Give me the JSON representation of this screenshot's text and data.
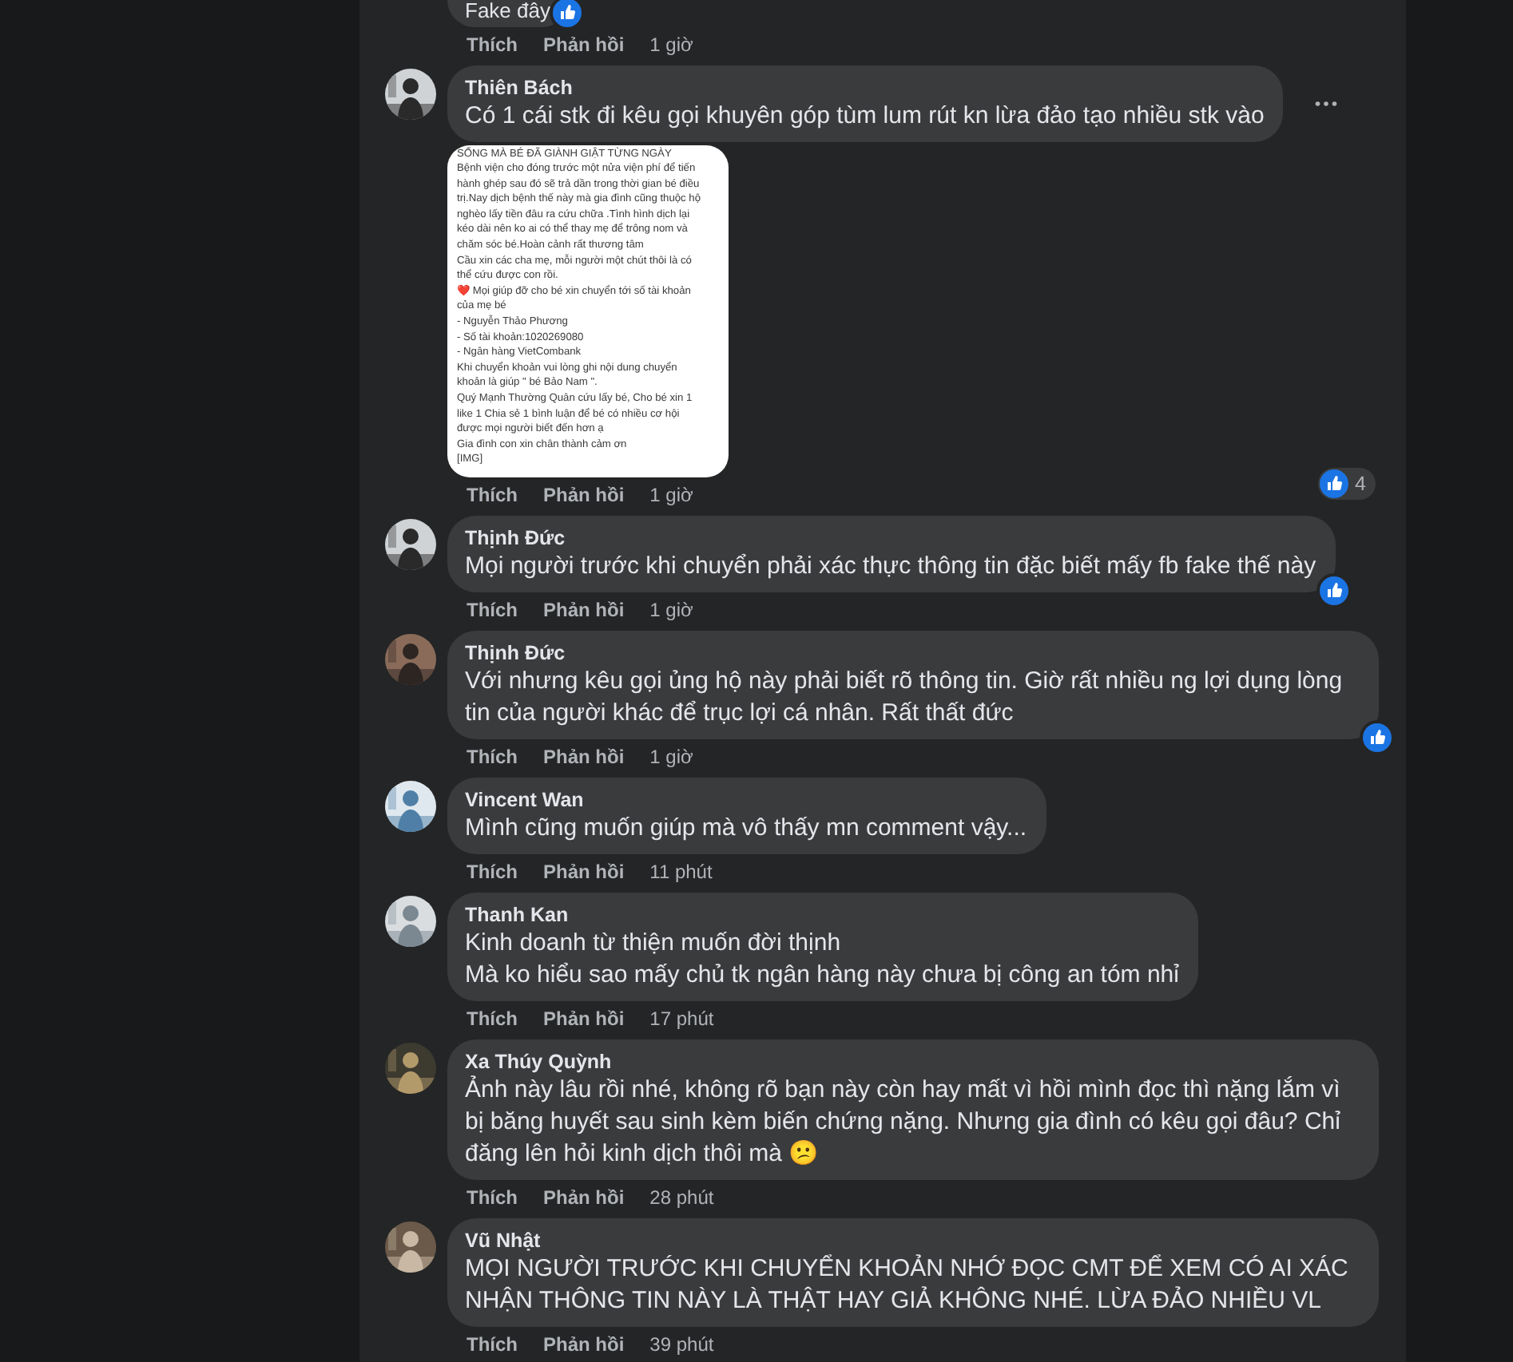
{
  "comments": [
    {
      "text": "Fake đây",
      "reaction": {
        "kind": "like"
      },
      "actions": {
        "like": "Thích",
        "reply": "Phản hồi",
        "time": "1 giờ"
      }
    },
    {
      "author": "Thiên Bách",
      "text": "Có 1 cái stk đi kêu gọi khuyên góp tùm lum rút kn lừa đảo tạo nhiều stk vào",
      "menu_button": true,
      "attachment": {
        "lines": [
          "SỐNG MÀ BÉ ĐÃ GIÀNH GIẬT TỪNG NGÀY",
          "Bệnh viện cho đóng trước một nửa viện phí để tiến",
          "hành ghép sau đó sẽ trả dần trong thời gian bé điều",
          "trị.Nay dịch bệnh thế này mà gia đình cũng thuộc hộ",
          "nghèo lấy tiền đâu ra cứu chữa .Tình hình dịch lại",
          "kéo dài nên ko ai có thể thay mẹ để trông nom và",
          "chăm sóc bé.Hoàn cảnh rất thương tâm",
          "Cầu xin các cha mẹ, mỗi người một chút thôi là có",
          "thể cứu được con rồi.",
          "❤️ Mọi giúp đỡ cho bé xin chuyển tới số tài khoản",
          "của mẹ bé",
          "- Nguyễn Thảo Phương",
          "- Số tài khoản:1020269080",
          "- Ngân hàng VietCombank",
          "Khi chuyển khoản vui lòng ghi nội dung chuyển",
          "khoản là giúp \" bé Bảo Nam \".",
          "Quý Mạnh Thường Quân cứu lấy bé, Cho bé xin 1",
          "like 1 Chia sẻ 1 bình luận để bé có nhiều cơ hội",
          "được mọi người biết đến hơn ạ",
          "Gia đình con xin chân thành cảm ơn",
          "[IMG]"
        ],
        "reaction": {
          "kind": "like",
          "count": "4"
        }
      },
      "actions": {
        "like": "Thích",
        "reply": "Phản hồi",
        "time": "1 giờ"
      }
    },
    {
      "author": "Thịnh Đức",
      "text": "Mọi người trước khi chuyển phải xác thực thông tin đặc biết mấy fb fake thế này",
      "reaction": {
        "kind": "like"
      },
      "actions": {
        "like": "Thích",
        "reply": "Phản hồi",
        "time": "1 giờ"
      }
    },
    {
      "author": "Thịnh Đức",
      "text": "Với nhưng kêu gọi ủng hộ này phải biết rõ thông tin. Giờ rất nhiều ng lợi dụng lòng tin của người khác để trục lợi cá nhân. Rất thất đức",
      "reaction": {
        "kind": "like"
      },
      "actions": {
        "like": "Thích",
        "reply": "Phản hồi",
        "time": "1 giờ"
      }
    },
    {
      "author": "Vincent Wan",
      "text": "Mình cũng muốn giúp mà vô thấy mn comment vậy...",
      "actions": {
        "like": "Thích",
        "reply": "Phản hồi",
        "time": "11 phút"
      }
    },
    {
      "author": "Thanh Kan",
      "text": "Kinh doanh từ thiện muốn đời thịnh\nMà ko hiểu sao mấy chủ tk ngân hàng này chưa bị công an tóm nhỉ",
      "actions": {
        "like": "Thích",
        "reply": "Phản hồi",
        "time": "17 phút"
      }
    },
    {
      "author": "Xa Thúy Quỳnh",
      "text": "Ảnh này lâu rồi nhé, không rõ bạn này còn hay mất vì hồi mình đọc thì nặng lắm vì bị băng huyết sau sinh kèm biến chứng nặng. Nhưng gia đình có kêu gọi đâu? Chỉ đăng lên hỏi kinh dịch thôi mà 😕",
      "actions": {
        "like": "Thích",
        "reply": "Phản hồi",
        "time": "28 phút"
      }
    },
    {
      "author": "Vũ Nhật",
      "text": "MỌI NGƯỜI TRƯỚC KHI CHUYỂN KHOẢN NHỚ ĐỌC CMT ĐỂ XEM CÓ AI XÁC NHẬN THÔNG TIN NÀY LÀ THẬT HAY GIẢ KHÔNG NHÉ. LỪA ĐẢO NHIỀU VL",
      "actions": {
        "like": "Thích",
        "reply": "Phản hồi",
        "time": "39 phút"
      }
    }
  ]
}
